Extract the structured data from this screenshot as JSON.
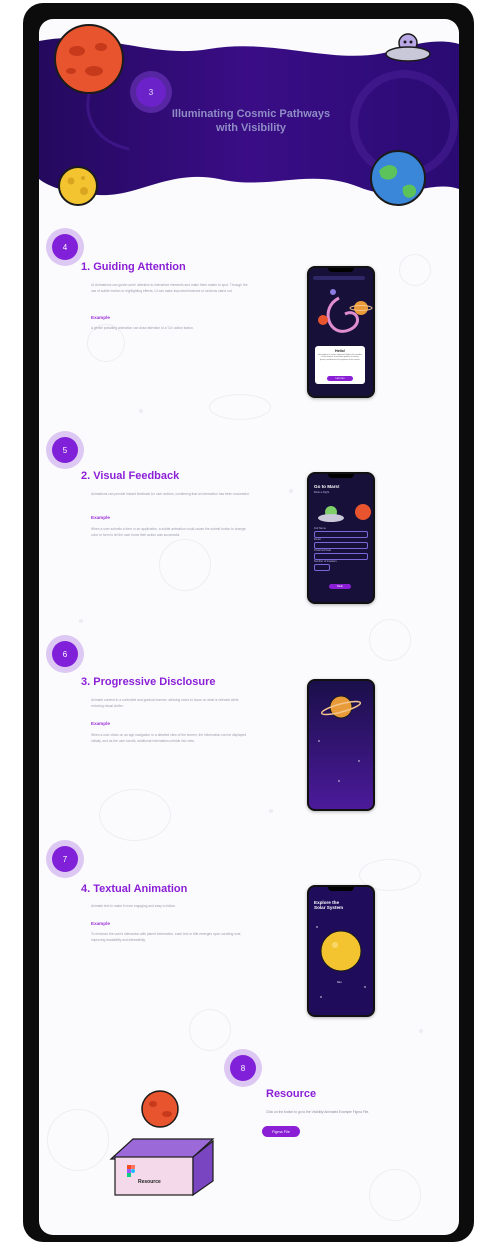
{
  "hero": {
    "step": "3",
    "title_line1": "Illuminating Cosmic Pathways",
    "title_line2": "with Visibility"
  },
  "sections": [
    {
      "step": "4",
      "title": "1. Guiding Attention",
      "body": "UI Animations can guide users' attention to interactive elements and make them easier to spot. Through the use of subtle motion or highlighting effects, UI can make important features or sections stand out.",
      "example_label": "Example",
      "example": "A gentle pulsating animation can draw attention to a 'Go' action button.",
      "phone": {
        "popup_title": "Hello!",
        "popup_text": "Get ready for a cosmic adventure! Explore the wonders of the universe, from distant galaxies to nearby planets, and discover the mysteries of the cosmos.",
        "button": "Let's Go"
      }
    },
    {
      "step": "5",
      "title": "2. Visual Feedback",
      "body": "Animations can provide instant feedback for user actions, confirming that an interaction has been successful.",
      "example_label": "Example",
      "example": "When a user submits a form in an application, a subtle animation could cause the submit button to change color or form to let the user know their action was successful.",
      "phone": {
        "title": "Go to Mars!",
        "subtitle": "Book a Flight",
        "fields": [
          "Full Name",
          "Email",
          "Preferred Date",
          "Number of travelers"
        ],
        "button": "Book"
      }
    },
    {
      "step": "6",
      "title": "3. Progressive Disclosure",
      "body": "Animate content in a controlled and gradual manner, allowing users to focus on what is relevant while reducing visual clutter.",
      "example_label": "Example",
      "example": "When a user clicks on an app navigation or a detailed view of the screen, the information can be displayed initially, and as the user scrolls, additional information unfolds into view.",
      "phone": {}
    },
    {
      "step": "7",
      "title": "4. Textual Animation",
      "body": "Animate text to make it more engaging and easy to follow.",
      "example_label": "Example",
      "example": "To enhance the user's interaction with planet information, each text or title emerges upon scrolling over, improving readability and interactivity.",
      "phone": {
        "title_line1": "Explore the",
        "title_line2": "Solar System",
        "caption": "Sun"
      }
    }
  ],
  "resource": {
    "step": "8",
    "title": "Resource",
    "body": "Click on the button to go to the Visibility Animated Example Figma File.",
    "button": "Figma File",
    "box_label": "Resource"
  },
  "colors": {
    "primary": "#8b1fd6",
    "hero_bg": "#2a0a6b",
    "phone_bg": "#17113a"
  }
}
